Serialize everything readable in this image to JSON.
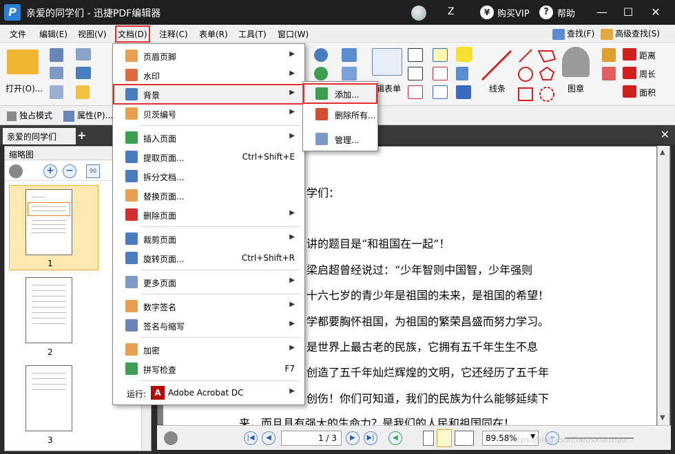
{
  "window": {
    "title": "亲爱的同学们 - 迅捷PDF编辑器",
    "user_initial": "Z",
    "buy_vip": "购买VIP",
    "help": "帮助"
  },
  "menubar": {
    "items": [
      "文件",
      "编辑(E)",
      "视图(V)",
      "文档(D)",
      "注释(C)",
      "表单(R)",
      "工具(T)",
      "窗口(W)"
    ],
    "find": "查找(F)",
    "advanced_find": "高级查找(S)"
  },
  "ribbon": {
    "open": "打开(O)...",
    "form": "辑表单",
    "line": "线条",
    "stamp": "图章",
    "distance": "距离",
    "perimeter": "周长",
    "area": "面积"
  },
  "subbar": {
    "exclusive_mode": "独占模式",
    "properties": "属性(P)..."
  },
  "tabs": {
    "doc_tab": "亲爱的同学们"
  },
  "thumbs": {
    "header": "缩略图",
    "pages": [
      "1",
      "2",
      "3"
    ]
  },
  "document": {
    "lines": [
      "学们：",
      "讲的题目是“和祖国在一起”！",
      "梁启超曾经说过：“少年智则中国智，少年强则",
      "十六七岁的青少年是祖国的未来，是祖国的希望！",
      "学都要胸怀祖国，为祖国的繁荣昌盛而努力学习。",
      "是世界上最古老的民族，它拥有五千年生生不息",
      "创造了五千年灿烂辉煌的文明，它还经历了五千年",
      "创伤！你们可知道，我们的民族为什么能够延续下",
      "来，而且具有强大的生命力？是我们的人民和祖国同在！"
    ]
  },
  "statusbar": {
    "page_current": "1",
    "page_total": "/ 3",
    "zoom": "89.58%"
  },
  "watermark": "https://blog.csdn.net/sxlaoxiao...",
  "document_menu": {
    "items": [
      {
        "label": "页眉页脚",
        "shortcut": "",
        "submenu": true
      },
      {
        "label": "水印",
        "shortcut": "",
        "submenu": true
      },
      {
        "label": "背景",
        "shortcut": "",
        "submenu": true
      },
      {
        "label": "贝茨编号",
        "shortcut": "",
        "submenu": true
      },
      {
        "label": "插入页面",
        "shortcut": "",
        "submenu": true
      },
      {
        "label": "提取页面...",
        "shortcut": "Ctrl+Shift+E",
        "submenu": false
      },
      {
        "label": "拆分文档...",
        "shortcut": "",
        "submenu": false
      },
      {
        "label": "替换页面...",
        "shortcut": "",
        "submenu": false
      },
      {
        "label": "删除页面",
        "shortcut": "",
        "submenu": true
      },
      {
        "label": "裁剪页面",
        "shortcut": "",
        "submenu": true
      },
      {
        "label": "旋转页面...",
        "shortcut": "Ctrl+Shift+R",
        "submenu": false
      },
      {
        "label": "更多页面",
        "shortcut": "",
        "submenu": true
      },
      {
        "label": "数字签名",
        "shortcut": "",
        "submenu": true
      },
      {
        "label": "签名与缩写",
        "shortcut": "",
        "submenu": true
      },
      {
        "label": "加密",
        "shortcut": "",
        "submenu": true
      },
      {
        "label": "拼写检查",
        "shortcut": "F7",
        "submenu": false
      }
    ],
    "run_label": "运行:",
    "run_app": "Adobe Acrobat DC"
  },
  "background_submenu": {
    "items": [
      "添加...",
      "删除所有...",
      "管理..."
    ]
  },
  "colors": {
    "highlight": "#e03030",
    "titlebar": "#1f1f1f"
  }
}
